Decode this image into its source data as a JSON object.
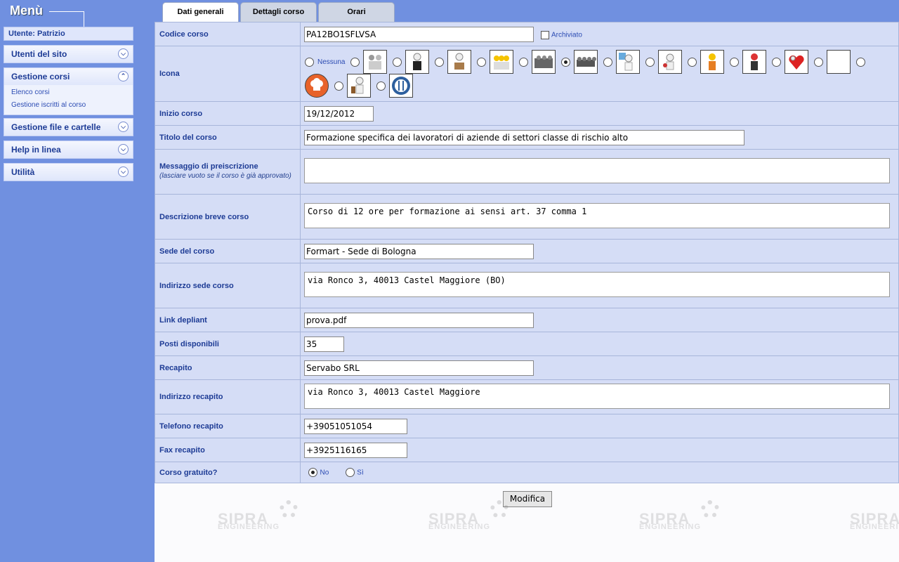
{
  "sidebar": {
    "title": "Menù",
    "user": "Utente: Patrizio",
    "sections": [
      {
        "label": "Utenti del sito",
        "expanded": false,
        "items": []
      },
      {
        "label": "Gestione corsi",
        "expanded": true,
        "items": [
          "Elenco corsi",
          "Gestione iscritti al corso"
        ]
      },
      {
        "label": "Gestione file e cartelle",
        "expanded": false,
        "items": []
      },
      {
        "label": "Help in linea",
        "expanded": false,
        "items": []
      },
      {
        "label": "Utilità",
        "expanded": false,
        "items": []
      }
    ]
  },
  "tabs": [
    {
      "label": "Dati generali",
      "active": true
    },
    {
      "label": "Dettagli corso",
      "active": false
    },
    {
      "label": "Orari",
      "active": false
    }
  ],
  "form": {
    "codice": {
      "label": "Codice corso",
      "value": "PA12BO1SFLVSA",
      "archiviato_label": "Archiviato",
      "archiviato": false
    },
    "icona": {
      "label": "Icona",
      "none_label": "Nessuna",
      "selected_index": 5,
      "icons": [
        "workers-group-icon",
        "businessman-icon",
        "worker-sitting-icon",
        "workers-team-icon",
        "crowd-icon",
        "crowd-selected-icon",
        "painter-icon",
        "mechanic-icon",
        "construction-worker-icon",
        "firefighter-icon",
        "heart-rescue-icon",
        "blank-icon",
        "chef-hat-icon",
        "cleaner-icon",
        "restaurant-icon"
      ]
    },
    "inizio": {
      "label": "Inizio corso",
      "value": "19/12/2012"
    },
    "titolo": {
      "label": "Titolo del corso",
      "value": "Formazione specifica dei lavoratori di aziende di settori classe di rischio alto"
    },
    "messaggio": {
      "label": "Messaggio di preiscrizione",
      "hint": "(lasciare vuoto se il corso è già approvato)",
      "value": ""
    },
    "descrizione": {
      "label": "Descrizione breve corso",
      "value": "Corso di 12 ore per formazione ai sensi art. 37 comma 1"
    },
    "sede": {
      "label": "Sede del corso",
      "value": "Formart - Sede di Bologna"
    },
    "indirizzo_sede": {
      "label": "Indirizzo sede corso",
      "value": "via Ronco 3, 40013 Castel Maggiore (BO)"
    },
    "link": {
      "label": "Link depliant",
      "value": "prova.pdf"
    },
    "posti": {
      "label": "Posti disponibili",
      "value": "35"
    },
    "recapito": {
      "label": "Recapito",
      "value": "Servabo SRL"
    },
    "indirizzo_recapito": {
      "label": "Indirizzo recapito",
      "value": "via Ronco 3, 40013 Castel Maggiore"
    },
    "telefono": {
      "label": "Telefono recapito",
      "value": "+39051051054"
    },
    "fax": {
      "label": "Fax recapito",
      "value": "+3925116165"
    },
    "gratuito": {
      "label": "Corso gratuito?",
      "no_label": "No",
      "si_label": "Sì",
      "value": "No"
    }
  },
  "submit_label": "Modifica",
  "watermark": {
    "line1": "SIPRA",
    "line2": "ENGINEERING"
  },
  "colors": {
    "sidebar_bg": "#7090e0",
    "label_text": "#1d3b95",
    "row_bg": "#d5ddf6",
    "border": "#a7b5da"
  }
}
